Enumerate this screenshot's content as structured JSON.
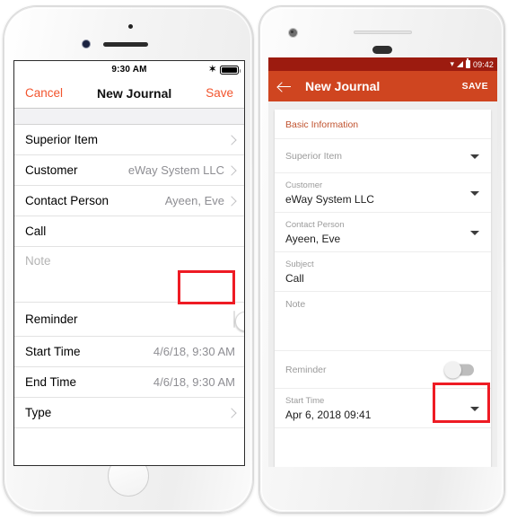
{
  "ios": {
    "status": {
      "time": "9:30 AM",
      "bluetooth_icon": "bluetooth-icon",
      "battery_icon": "battery-icon"
    },
    "nav": {
      "cancel_label": "Cancel",
      "title": "New Journal",
      "save_label": "Save"
    },
    "rows": [
      {
        "label": "Superior Item",
        "value": "",
        "accessory": "chevron-right-icon"
      },
      {
        "label": "Customer",
        "value": "eWay System LLC",
        "accessory": "chevron-right-icon"
      },
      {
        "label": "Contact Person",
        "value": "Ayeen,  Eve",
        "accessory": "chevron-right-icon"
      },
      {
        "label": "Call",
        "value": "",
        "accessory": "none"
      }
    ],
    "note": {
      "placeholder": "Note"
    },
    "reminder": {
      "label": "Reminder",
      "state": "off"
    },
    "time_rows": [
      {
        "label": "Start Time",
        "value": "4/6/18, 9:30 AM"
      },
      {
        "label": "End Time",
        "value": "4/6/18, 9:30 AM"
      }
    ],
    "type_row": {
      "label": "Type",
      "accessory": "chevron-right-icon"
    }
  },
  "android": {
    "status": {
      "time": "09:42",
      "wifi_icon": "wifi-icon",
      "signal_icon": "signal-icon",
      "battery_icon": "battery-icon"
    },
    "toolbar": {
      "back_icon": "back-arrow-icon",
      "title": "New Journal",
      "save_label": "SAVE"
    },
    "card_header": "Basic Information",
    "fields": [
      {
        "label": "Superior Item",
        "value": "",
        "accessory": "dropdown-caret-icon"
      },
      {
        "label": "Customer",
        "value": "eWay System LLC",
        "accessory": "dropdown-caret-icon"
      },
      {
        "label": "Contact Person",
        "value": "Ayeen,  Eve",
        "accessory": "dropdown-caret-icon"
      },
      {
        "label": "Subject",
        "value": "Call",
        "accessory": "none"
      },
      {
        "label": "Note",
        "value": "",
        "accessory": "none"
      }
    ],
    "reminder": {
      "label": "Reminder",
      "state": "off"
    },
    "start_time": {
      "label": "Start Time",
      "value": "Apr 6, 2018  09:41",
      "accessory": "dropdown-caret-icon"
    }
  },
  "colors": {
    "android_toolbar": "#cf4520",
    "android_status_bar": "#9c1b0f",
    "ios_accent": "#f2542d",
    "highlight_box": "#ee1b24",
    "card_header_text": "#c0532f"
  }
}
